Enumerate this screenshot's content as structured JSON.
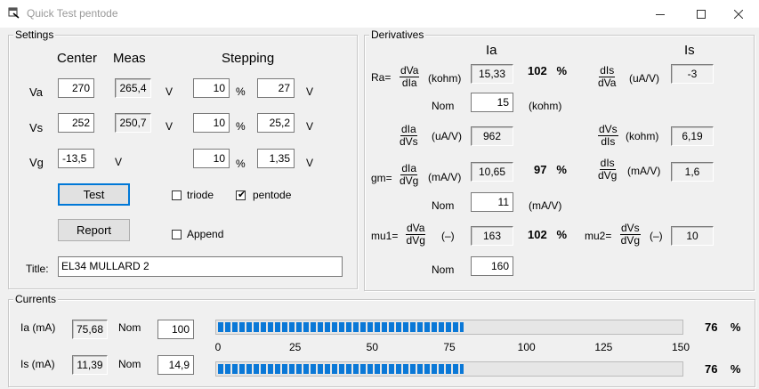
{
  "window": {
    "title": "Quick Test pentode"
  },
  "settings": {
    "group_label": "Settings",
    "hdr_center": "Center",
    "hdr_meas": "Meas",
    "hdr_stepping": "Stepping",
    "rows": [
      {
        "label": "Va",
        "center": "270",
        "meas": "265,4",
        "unit": "V",
        "step_pct": "10",
        "pct_sign": "%",
        "step_val": "27",
        "step_unit": "V"
      },
      {
        "label": "Vs",
        "center": "252",
        "meas": "250,7",
        "unit": "V",
        "step_pct": "10",
        "pct_sign": "%",
        "step_val": "25,2",
        "step_unit": "V"
      },
      {
        "label": "Vg",
        "center": "-13,5",
        "unit": "V",
        "step_pct": "10",
        "pct_sign": "%",
        "step_val": "1,35",
        "step_unit": "V"
      }
    ],
    "test_label": "Test",
    "report_label": "Report",
    "triode_label": "triode",
    "triode_checked": false,
    "pentode_label": "pentode",
    "pentode_checked": true,
    "append_label": "Append",
    "append_checked": false,
    "title_label": "Title:",
    "title_value": "EL34 MULLARD 2"
  },
  "derivatives": {
    "group_label": "Derivatives",
    "hdr_ia": "Ia",
    "hdr_is": "Is",
    "ra": {
      "prefix": "Ra=",
      "num": "dVa",
      "den": "dIa",
      "unit": "(kohm)",
      "value": "15,33",
      "pct": "102",
      "pct_sign": "%",
      "nom_label": "Nom",
      "nom_value": "15",
      "nom_unit": "(kohm)"
    },
    "dis_dva": {
      "num": "dIs",
      "den": "dVa",
      "unit": "(uA/V)",
      "value": "-3"
    },
    "dia_dvs": {
      "num": "dIa",
      "den": "dVs",
      "unit": "(uA/V)",
      "value": "962"
    },
    "dvs_dis": {
      "num": "dVs",
      "den": "dIs",
      "unit": "(kohm)",
      "value": "6,19"
    },
    "gm": {
      "prefix": "gm=",
      "num": "dIa",
      "den": "dVg",
      "unit": "(mA/V)",
      "value": "10,65",
      "pct": "97",
      "pct_sign": "%",
      "nom_label": "Nom",
      "nom_value": "11",
      "nom_unit": "(mA/V)"
    },
    "dis_dvg": {
      "num": "dIs",
      "den": "dVg",
      "unit": "(mA/V)",
      "value": "1,6"
    },
    "mu1": {
      "prefix": "mu1=",
      "num": "dVa",
      "den": "dVg",
      "unit": "(–)",
      "value": "163",
      "pct": "102",
      "pct_sign": "%",
      "nom_label": "Nom",
      "nom_value": "160"
    },
    "mu2": {
      "prefix": "mu2=",
      "num": "dVs",
      "den": "dVg",
      "unit": "(–)",
      "value": "10"
    }
  },
  "currents": {
    "group_label": "Currents",
    "ia": {
      "label": "Ia (mA)",
      "value": "75,68",
      "nom_label": "Nom",
      "nom_value": "100",
      "pct": "76",
      "pct_sign": "%",
      "bar_fraction": 0.53
    },
    "is": {
      "label": "Is (mA)",
      "value": "11,39",
      "nom_label": "Nom",
      "nom_value": "14,9",
      "pct": "76",
      "pct_sign": "%",
      "bar_fraction": 0.53
    },
    "scale_ticks": [
      "0",
      "25",
      "50",
      "75",
      "100",
      "125",
      "150"
    ]
  },
  "colors": {
    "progress": "#0a78d7",
    "focus_border": "#0078d7"
  },
  "icons": {
    "app": "app-icon",
    "minimize": "minimize-icon",
    "maximize": "maximize-icon",
    "close": "close-icon"
  }
}
